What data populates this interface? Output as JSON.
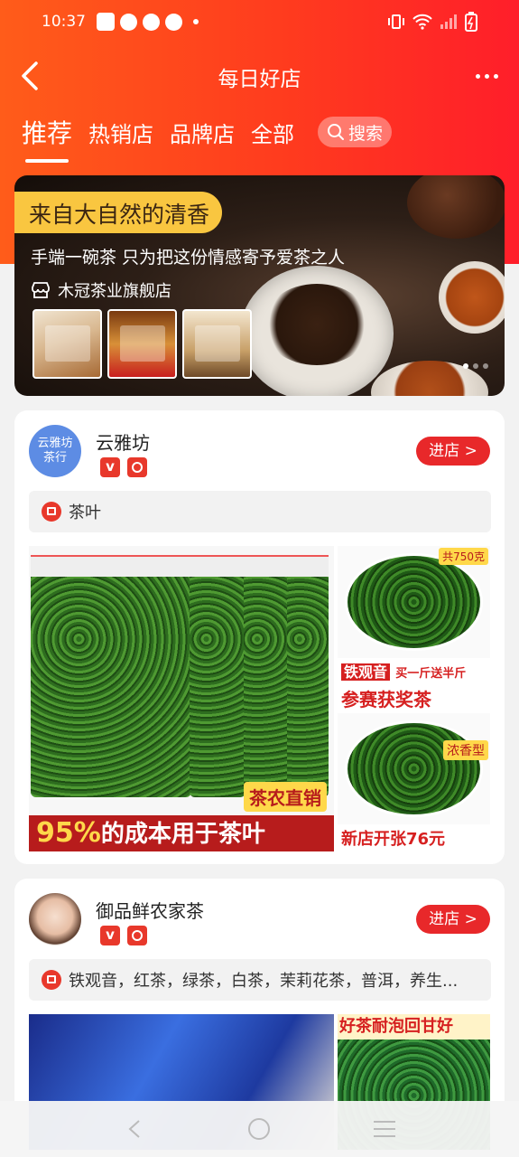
{
  "status": {
    "time": "10:37"
  },
  "nav": {
    "title": "每日好店"
  },
  "tabs": [
    {
      "label": "推荐",
      "active": true
    },
    {
      "label": "热销店"
    },
    {
      "label": "品牌店"
    },
    {
      "label": "全部"
    }
  ],
  "search": {
    "label": "搜索"
  },
  "banner": {
    "tag": "来自大自然的清香",
    "subtitle": "手端一碗茶 只为把这份情感寄予爱茶之人",
    "store": "木冠茶业旗舰店"
  },
  "stores": [
    {
      "name": "云雅坊",
      "avatar_text": "云雅坊茶行",
      "enter_label": "进店 >",
      "category": "茶叶",
      "main_image": {
        "ribbon_pct": "95%",
        "ribbon_text": "的成本用于茶叶",
        "tag": "茶农直销"
      },
      "side_image": {
        "top_tag": "共750克",
        "label_hl": "铁观音",
        "label": "买一斤送半斤",
        "award": "参赛获奖茶",
        "side_tag": "浓香型",
        "promo": "新店开张76元"
      }
    },
    {
      "name": "御品鲜农家茶",
      "enter_label": "进店 >",
      "category": "铁观音，红茶，绿茶，白茶，茉莉花茶，普洱，养生...",
      "side_image": {
        "top_text": "好茶耐泡回甘好"
      }
    }
  ],
  "colors": {
    "accent": "#ff3b1e",
    "enter_button": "#e8282a",
    "banner_tag": "#f9c640"
  }
}
